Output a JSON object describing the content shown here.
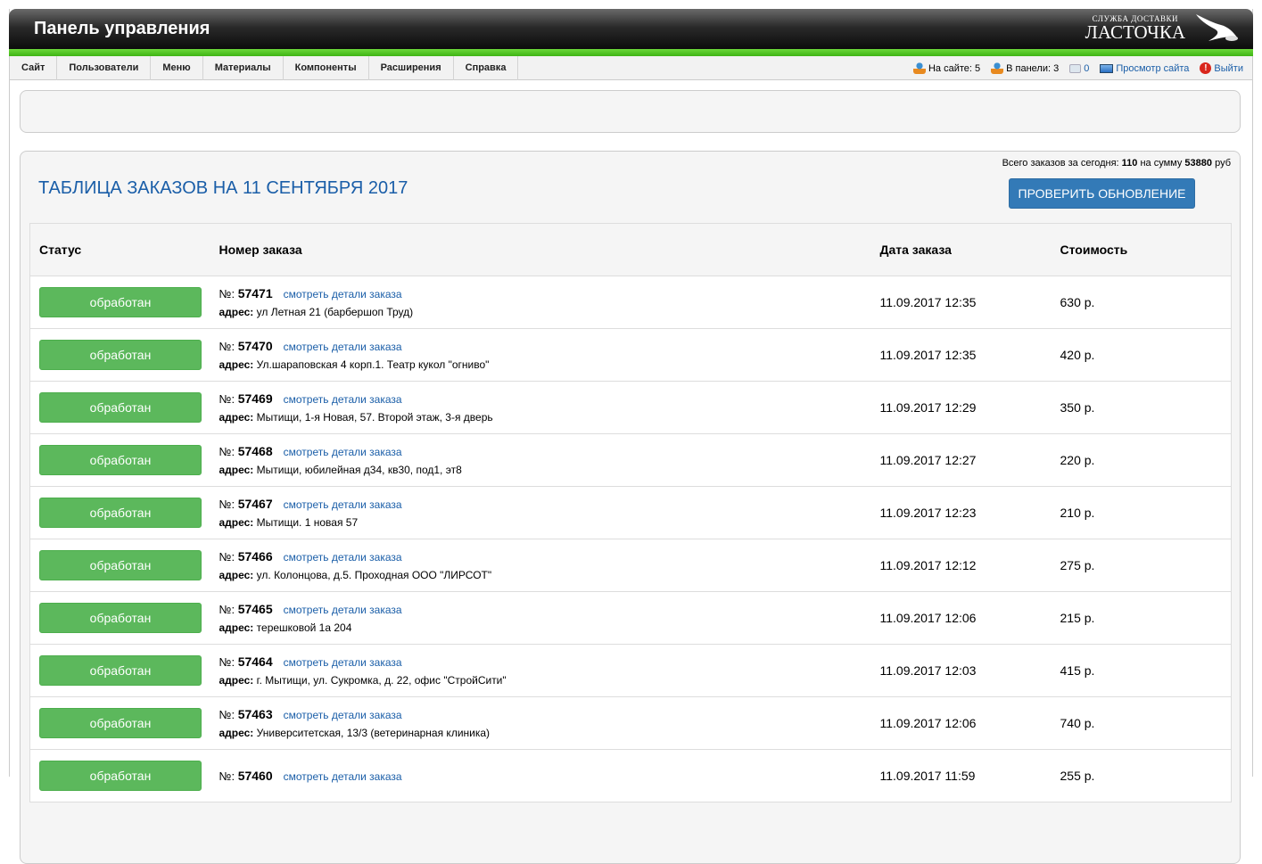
{
  "header": {
    "title": "Панель управления",
    "logo_line1": "СЛУЖБА ДОСТАВКИ",
    "logo_line2": "ЛАСТОЧКА"
  },
  "menu": [
    "Сайт",
    "Пользователи",
    "Меню",
    "Материалы",
    "Компоненты",
    "Расширения",
    "Справка"
  ],
  "status": {
    "on_site": "На сайте: 5",
    "in_panel": "В панели: 3",
    "messages": "0",
    "view_site": "Просмотр сайта",
    "logout": "Выйти"
  },
  "orders": {
    "summary_prefix": "Всего заказов за сегодня:",
    "summary_count": "110",
    "summary_mid": "на сумму",
    "summary_sum": "53880",
    "summary_suffix": "руб",
    "title": "ТАБЛИЦА ЗАКАЗОВ НА 11 СЕНТЯБРЯ 2017",
    "check_button": "ПРОВЕРИТЬ ОБНОВЛЕНИЕ",
    "columns": [
      "Статус",
      "Номер заказа",
      "Дата заказа",
      "Стоимость"
    ],
    "num_label": "№:",
    "details_link": "смотреть детали заказа",
    "addr_label": "адрес:",
    "rows": [
      {
        "status": "обработан",
        "number": "57471",
        "address": "ул Летная 21 (барбершоп Труд)",
        "date": "11.09.2017 12:35",
        "price": "630 р."
      },
      {
        "status": "обработан",
        "number": "57470",
        "address": "Ул.шараповская 4 корп.1. Театр кукол \"огниво\"",
        "date": "11.09.2017 12:35",
        "price": "420 р."
      },
      {
        "status": "обработан",
        "number": "57469",
        "address": "Мытищи, 1-я Новая, 57. Второй этаж, 3-я дверь",
        "date": "11.09.2017 12:29",
        "price": "350 р."
      },
      {
        "status": "обработан",
        "number": "57468",
        "address": "Мытищи, юбилейная д34, кв30, под1, эт8",
        "date": "11.09.2017 12:27",
        "price": "220 р."
      },
      {
        "status": "обработан",
        "number": "57467",
        "address": "Мытищи. 1 новая 57",
        "date": "11.09.2017 12:23",
        "price": "210 р."
      },
      {
        "status": "обработан",
        "number": "57466",
        "address": "ул. Колонцова, д.5. Проходная ООО \"ЛИРСОТ\"",
        "date": "11.09.2017 12:12",
        "price": "275 р."
      },
      {
        "status": "обработан",
        "number": "57465",
        "address": "терешковой 1а 204",
        "date": "11.09.2017 12:06",
        "price": "215 р."
      },
      {
        "status": "обработан",
        "number": "57464",
        "address": "г. Мытищи, ул. Сукромка, д. 22, офис \"СтройСити\"",
        "date": "11.09.2017 12:03",
        "price": "415 р."
      },
      {
        "status": "обработан",
        "number": "57463",
        "address": "Университетская, 13/3 (ветеринарная клиника)",
        "date": "11.09.2017 12:06",
        "price": "740 р."
      },
      {
        "status": "обработан",
        "number": "57460",
        "address": "",
        "date": "11.09.2017 11:59",
        "price": "255 р."
      }
    ]
  }
}
